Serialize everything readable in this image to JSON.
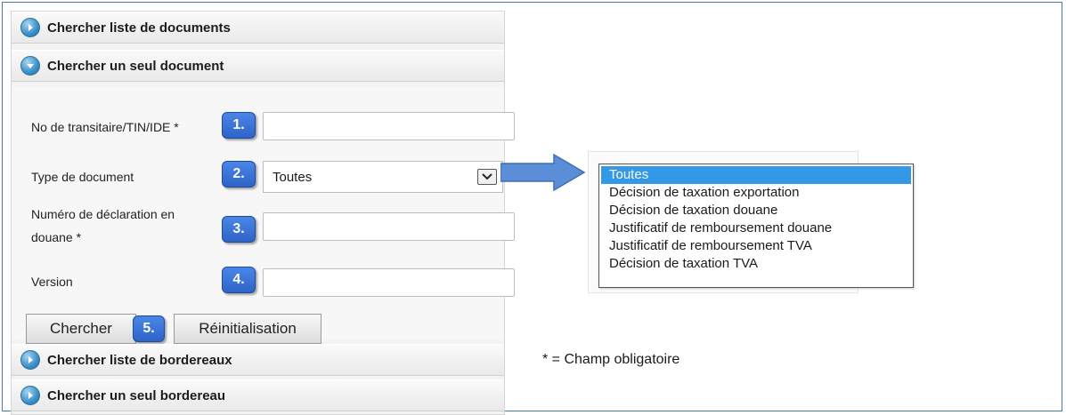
{
  "accordion": {
    "search_documents": "Chercher liste de documents",
    "search_single_document": "Chercher un seul document",
    "search_slips": "Chercher liste de bordereaux",
    "search_single_slip": "Chercher un seul bordereau"
  },
  "form": {
    "field1": {
      "label": "No de transitaire/TIN/IDE *",
      "badge": "1.",
      "value": ""
    },
    "field2": {
      "label": "Type de document",
      "badge": "2.",
      "value": "Toutes"
    },
    "field3": {
      "label_line1": "Numéro de déclaration en",
      "label_line2": "douane *",
      "badge": "3.",
      "value": ""
    },
    "field4": {
      "label": "Version",
      "badge": "4.",
      "value": ""
    },
    "buttons": {
      "search": "Chercher",
      "badge": "5.",
      "reset": "Réinitialisation"
    }
  },
  "dropdown": {
    "options": [
      "Toutes",
      "Décision de taxation exportation",
      "Décision de taxation douane",
      "Justificatif de remboursement douane",
      "Justificatif de remboursement TVA",
      "Décision de taxation TVA"
    ],
    "selected_index": 0
  },
  "note": "* = Champ obligatoire",
  "colors": {
    "badge": "#3a72d8",
    "selected_option": "#3399e6",
    "accordion_icon": "#3a8fc6",
    "arrow": "#5b8ed6"
  }
}
